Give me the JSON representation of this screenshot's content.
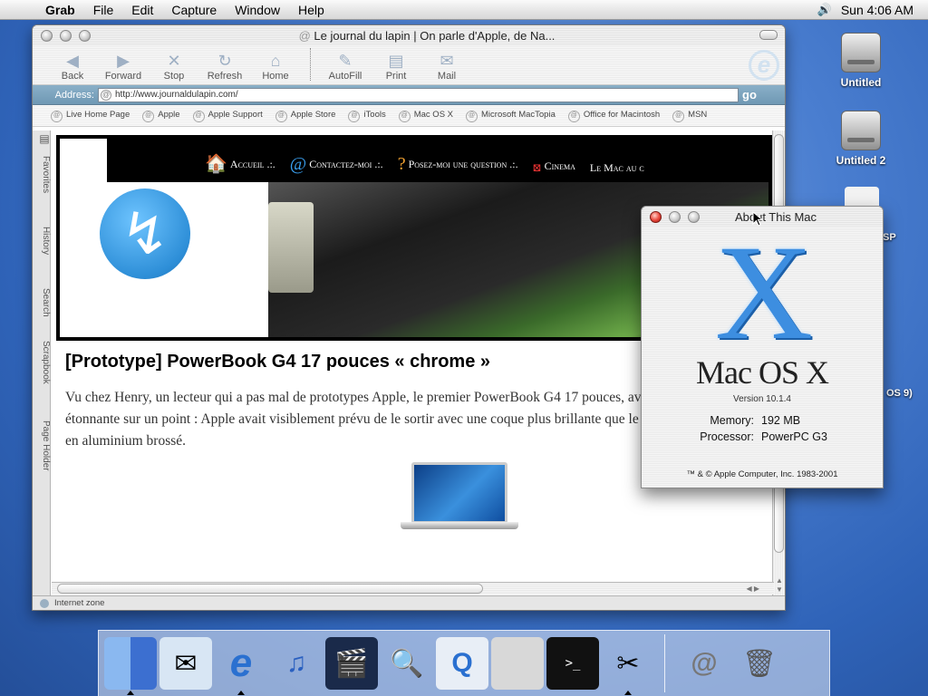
{
  "menubar": {
    "app": "Grab",
    "items": [
      "File",
      "Edit",
      "Capture",
      "Window",
      "Help"
    ],
    "clock": "Sun 4:06 AM"
  },
  "desktop": {
    "icons": [
      {
        "label": "Untitled"
      },
      {
        "label": "Untitled 2"
      }
    ],
    "partial_labels": [
      "SP",
      "OS 9)"
    ]
  },
  "browser": {
    "title": "Le journal du lapin | On parle d'Apple, de Na...",
    "toolbar": [
      "Back",
      "Forward",
      "Stop",
      "Refresh",
      "Home",
      "AutoFill",
      "Print",
      "Mail"
    ],
    "address_label": "Address:",
    "address_value": "http://www.journaldulapin.com/",
    "go_label": "go",
    "favorites": [
      "Live Home Page",
      "Apple",
      "Apple Support",
      "Apple Store",
      "iTools",
      "Mac OS X",
      "Microsoft MacTopia",
      "Office for Macintosh",
      "MSN"
    ],
    "side_tabs": [
      "Favorites",
      "History",
      "Search",
      "Scrapbook",
      "Page Holder"
    ],
    "status": "Internet zone",
    "page": {
      "nav": [
        "Accueil .:.",
        "Contactez-moi .:.",
        "Posez-moi une question .:.",
        "Cinema",
        "Le Mac au c"
      ],
      "headline": "[Prototype] PowerBook G4 17 pouces « chrome »",
      "body": "Vu chez Henry, un lecteur qui a pas mal de prototypes Apple, le premier PowerBook G4 17 pouces, avec une particularité étonnante sur un point : Apple avait visiblement prévu de le sortir avec une coque plus brillante que le modèle final, qui est en aluminium brossé."
    }
  },
  "about": {
    "title": "About This Mac",
    "logo_letter": "X",
    "os_name": "Mac OS X",
    "version": "Version 10.1.4",
    "memory_label": "Memory:",
    "memory_value": "192 MB",
    "processor_label": "Processor:",
    "processor_value": "PowerPC G3",
    "copyright": "™ & © Apple Computer, Inc. 1983-2001"
  },
  "dock": [
    "finder-icon",
    "mail-icon",
    "internet-explorer-icon",
    "itunes-icon",
    "imovie-icon",
    "sherlock-icon",
    "quicktime-icon",
    "system-preferences-icon",
    "terminal-icon",
    "grab-icon",
    "internet-connect-icon",
    "trash-icon"
  ]
}
